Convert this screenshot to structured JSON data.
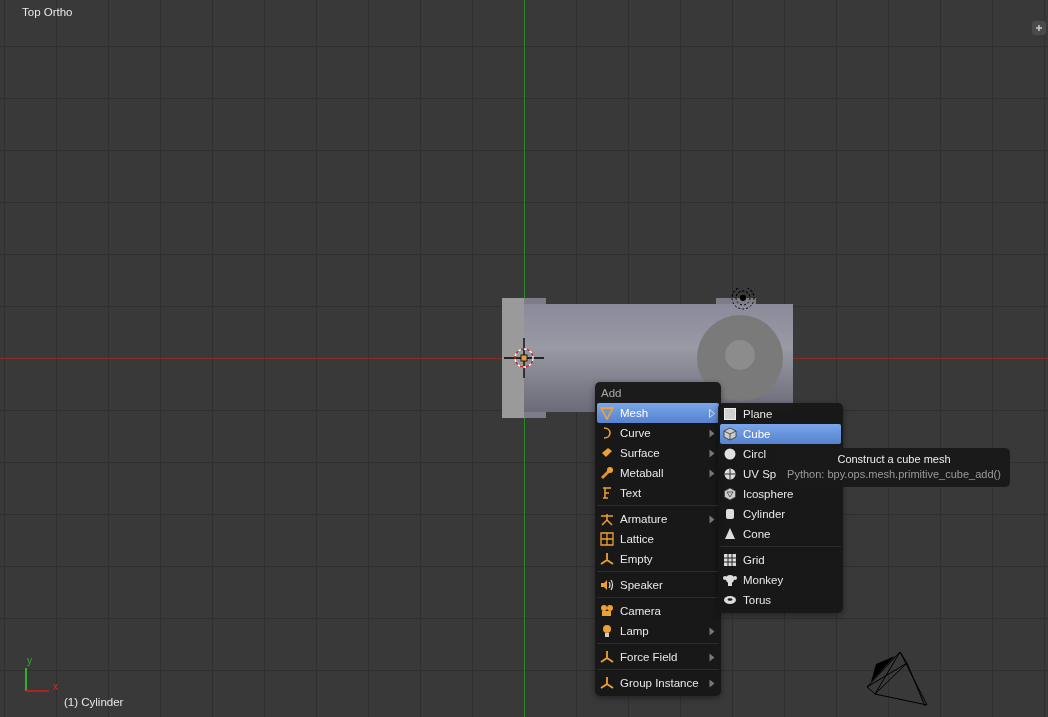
{
  "viewport": {
    "title": "Top Ortho",
    "object_info": "(1) Cylinder",
    "axis_x": "x",
    "axis_y": "y"
  },
  "add_menu": {
    "title": "Add",
    "sections": [
      [
        {
          "label": "Mesh",
          "submenu": true,
          "selected": true
        },
        {
          "label": "Curve",
          "submenu": true,
          "selected": false
        },
        {
          "label": "Surface",
          "submenu": true,
          "selected": false
        },
        {
          "label": "Metaball",
          "submenu": true,
          "selected": false
        },
        {
          "label": "Text",
          "submenu": false,
          "selected": false
        }
      ],
      [
        {
          "label": "Armature",
          "submenu": true,
          "selected": false
        },
        {
          "label": "Lattice",
          "submenu": false,
          "selected": false
        },
        {
          "label": "Empty",
          "submenu": false,
          "selected": false
        }
      ],
      [
        {
          "label": "Speaker",
          "submenu": false,
          "selected": false
        }
      ],
      [
        {
          "label": "Camera",
          "submenu": false,
          "selected": false
        },
        {
          "label": "Lamp",
          "submenu": true,
          "selected": false
        }
      ],
      [
        {
          "label": "Force Field",
          "submenu": true,
          "selected": false
        }
      ],
      [
        {
          "label": "Group Instance",
          "submenu": true,
          "selected": false
        }
      ]
    ]
  },
  "mesh_menu": {
    "sections": [
      [
        {
          "label": "Plane",
          "selected": false
        },
        {
          "label": "Cube",
          "selected": true
        },
        {
          "label": "Circl",
          "selected": false
        },
        {
          "label": "UV Sp",
          "selected": false
        },
        {
          "label": "Icosphere",
          "selected": false
        },
        {
          "label": "Cylinder",
          "selected": false
        },
        {
          "label": "Cone",
          "selected": false
        }
      ],
      [
        {
          "label": "Grid",
          "selected": false
        },
        {
          "label": "Monkey",
          "selected": false
        },
        {
          "label": "Torus",
          "selected": false
        }
      ]
    ]
  },
  "tooltip": {
    "description": "Construct a cube mesh",
    "python": "Python: bpy.ops.mesh.primitive_cube_add()"
  }
}
